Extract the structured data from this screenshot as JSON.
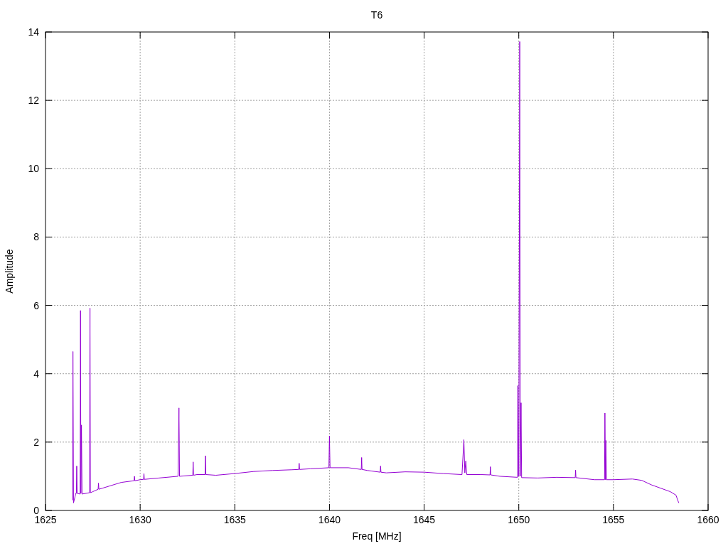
{
  "plot": {
    "chart_data": {
      "type": "line",
      "grid": true,
      "title": "T6",
      "xlabel": "Freq [MHz]",
      "ylabel": "Amplitude",
      "xlim": [
        1625,
        1660
      ],
      "ylim": [
        0,
        14
      ],
      "xticks": [
        1625,
        1630,
        1635,
        1640,
        1645,
        1650,
        1655,
        1660
      ],
      "yticks": [
        0,
        2,
        4,
        6,
        8,
        10,
        12,
        14
      ],
      "x": [
        1626.43,
        1626.45,
        1626.48,
        1626.6,
        1626.63,
        1626.65,
        1626.67,
        1626.83,
        1626.85,
        1626.87,
        1626.9,
        1626.93,
        1627.33,
        1627.35,
        1627.37,
        1627.5,
        1627.78,
        1627.8,
        1627.82,
        1628,
        1629,
        1629.68,
        1629.7,
        1629.72,
        1630,
        1630.18,
        1630.2,
        1630.22,
        1631,
        1632,
        1632.05,
        1632.08,
        1632.78,
        1632.8,
        1632.82,
        1633,
        1633.43,
        1633.45,
        1633.47,
        1634,
        1635,
        1636,
        1637,
        1638,
        1638.38,
        1638.4,
        1638.42,
        1639,
        1639.97,
        1640,
        1640.03,
        1641,
        1641.68,
        1641.7,
        1641.72,
        1642,
        1642.68,
        1642.7,
        1642.72,
        1643,
        1644,
        1645,
        1646,
        1647,
        1647.1,
        1647.15,
        1647.2,
        1647.25,
        1648,
        1648.48,
        1648.5,
        1648.52,
        1649,
        1649.93,
        1649.95,
        1650,
        1650.05,
        1650.08,
        1650.12,
        1650.15,
        1651,
        1652,
        1652.98,
        1653,
        1653.02,
        1654,
        1654.53,
        1654.55,
        1654.58,
        1654.6,
        1654.63,
        1655,
        1656,
        1656.5,
        1657,
        1658,
        1658.3,
        1658.45
      ],
      "series": [
        {
          "color": "#9400d3",
          "values": [
            0.3,
            4.65,
            0.22,
            0.5,
            0.5,
            1.3,
            0.5,
            0.48,
            5.85,
            0.5,
            2.5,
            0.48,
            0.52,
            5.92,
            0.52,
            0.55,
            0.62,
            0.8,
            0.62,
            0.65,
            0.82,
            0.87,
            1.0,
            0.87,
            0.9,
            0.91,
            1.08,
            0.91,
            0.95,
            1.0,
            3.0,
            1.0,
            1.03,
            1.42,
            1.03,
            1.05,
            1.05,
            1.6,
            1.05,
            1.03,
            1.08,
            1.14,
            1.17,
            1.19,
            1.2,
            1.38,
            1.2,
            1.22,
            1.25,
            2.18,
            1.25,
            1.25,
            1.2,
            1.55,
            1.2,
            1.17,
            1.12,
            1.3,
            1.12,
            1.1,
            1.13,
            1.12,
            1.08,
            1.05,
            2.07,
            1.1,
            1.45,
            1.05,
            1.05,
            1.04,
            1.28,
            1.04,
            1.0,
            0.97,
            3.65,
            1.0,
            13.72,
            1.0,
            3.15,
            0.96,
            0.95,
            0.97,
            0.96,
            1.18,
            0.96,
            0.9,
            0.9,
            2.85,
            0.9,
            2.05,
            0.9,
            0.9,
            0.92,
            0.88,
            0.75,
            0.55,
            0.45,
            0.22
          ]
        }
      ]
    }
  }
}
